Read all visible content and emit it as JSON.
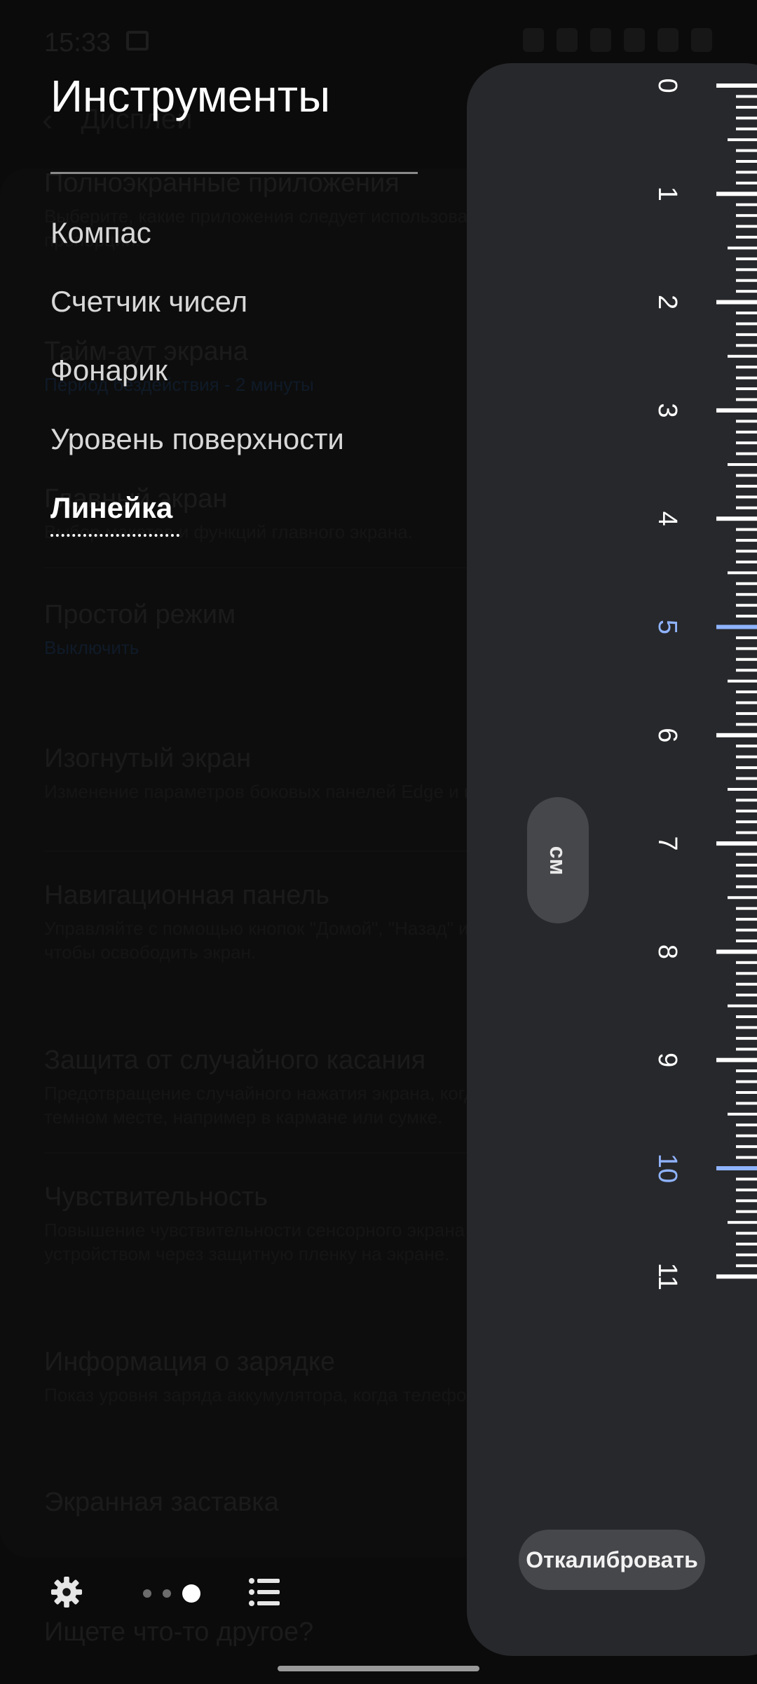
{
  "status_bar": {
    "time": "15:33"
  },
  "background_page": {
    "title": "Дисплей",
    "items": [
      {
        "title": "Полноэкранные приложения",
        "subtitle": "Выберите, какие приложения следует использовать в полноэкранном пропорции."
      },
      {
        "title": "Тайм-аут экрана",
        "subtitle": "Период бездействия - 2 минуты",
        "subtitle_blue": true
      },
      {
        "title": "Главный экран",
        "subtitle": "Выбор макетов и функций главного экрана."
      },
      {
        "title": "Простой режим",
        "subtitle": "Выключить",
        "subtitle_blue": true
      },
      {
        "title": "Изогнутый экран",
        "subtitle": "Изменение параметров боковых панелей Edge и подсветки экрана."
      },
      {
        "title": "Навигационная панель",
        "subtitle": "Управляйте с помощью кнопок \"Домой\", \"Назад\" или используйте жесты, чтобы освободить экран."
      },
      {
        "title": "Защита от случайного касания",
        "subtitle": "Предотвращение случайного нажатия экрана, когда он находится в темном месте, например в кармане или сумке."
      },
      {
        "title": "Чувствительность",
        "subtitle": "Повышение чувствительности сенсорного экрана для управления устройством через защитную пленку на экране."
      },
      {
        "title": "Информация о зарядке",
        "subtitle": "Показ уровня заряда аккумулятора, когда телефон не используется."
      },
      {
        "title": "Экранная заставка",
        "subtitle": ""
      }
    ],
    "footer": "Ищете что-то другое?"
  },
  "tools_menu": {
    "title": "Инструменты",
    "items": [
      {
        "label": "Компас",
        "active": false
      },
      {
        "label": "Счетчик чисел",
        "active": false
      },
      {
        "label": "Фонарик",
        "active": false
      },
      {
        "label": "Уровень поверхности",
        "active": false
      },
      {
        "label": "Линейка",
        "active": true
      }
    ],
    "icons": {
      "settings": "gear-icon",
      "page_indicator": "page-dots",
      "list": "list-icon"
    },
    "page_indicator": {
      "count": 3,
      "active_index": 2
    }
  },
  "ruler": {
    "unit": "см",
    "calibrate_label": "Откалибровать",
    "numbers": [
      "0",
      "1",
      "2",
      "3",
      "4",
      "5",
      "6",
      "7",
      "8",
      "9",
      "10",
      "11"
    ],
    "highlight_numbers": [
      "5",
      "10"
    ],
    "colors": {
      "tick": "#ffffff",
      "highlight": "#8fb3ff",
      "panel": "#27282b"
    }
  }
}
